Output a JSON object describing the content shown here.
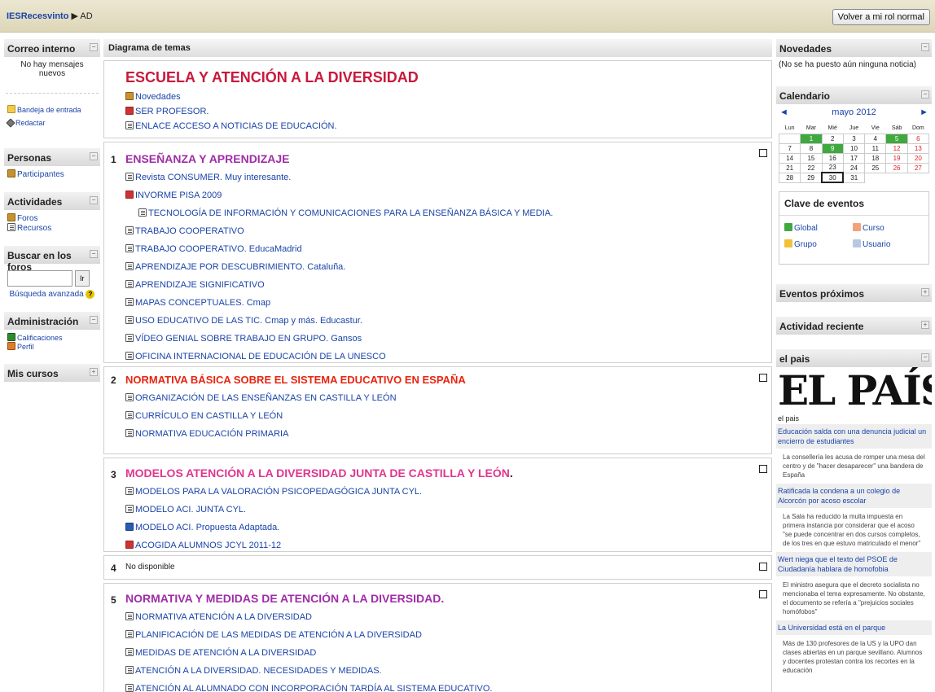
{
  "topbar": {
    "home": "IESRecesvinto",
    "sep": "▶",
    "current": "AD",
    "role_button": "Volver a mi rol normal"
  },
  "left": {
    "mail": {
      "title": "Correo interno",
      "no_msgs": "No hay mensajes nuevos",
      "inbox": "Bandeja de entrada",
      "compose": "Redactar"
    },
    "people": {
      "title": "Personas",
      "participants": "Participantes"
    },
    "activities": {
      "title": "Actividades",
      "forums": "Foros",
      "resources": "Recursos"
    },
    "search": {
      "title": "Buscar en los foros",
      "go": "Ir",
      "advanced": "Búsqueda avanzada",
      "help": "?"
    },
    "admin": {
      "title": "Administración",
      "grades": "Calificaciones",
      "profile": "Perfil"
    },
    "courses": {
      "title": "Mis cursos"
    }
  },
  "main": {
    "header": "Diagrama de temas",
    "sec0": {
      "title": "ESCUELA Y ATENCIÓN A LA DIVERSIDAD",
      "items": [
        "Novedades",
        "SER PROFESOR.",
        "ENLACE ACCESO A NOTICIAS DE EDUCACIÓN."
      ]
    },
    "sec1": {
      "num": "1",
      "title": "ENSEÑANZA Y APRENDIZAJE",
      "items": [
        "Revista CONSUMER. Muy interesante.",
        "INVORME PISA 2009",
        "TECNOLOGÍA DE INFORMACIÓN Y COMUNICACIONES PARA LA ENSEÑANZA BÁSICA Y MEDIA.",
        "TRABAJO COOPERATIVO",
        "TRABAJO COOPERATIVO. EducaMadrid",
        "APRENDIZAJE POR DESCUBRIMIENTO. Cataluña.",
        "APRENDIZAJE SIGNIFICATIVO",
        "MAPAS CONCEPTUALES. Cmap",
        "USO EDUCATIVO DE LAS TIC. Cmap y más. Educastur.",
        "VÍDEO GENIAL SOBRE TRABAJO EN GRUPO. Gansos",
        "OFICINA INTERNACIONAL DE EDUCACIÓN DE LA UNESCO"
      ]
    },
    "sec2": {
      "num": "2",
      "title": "NORMATIVA BÁSICA SOBRE EL SISTEMA EDUCATIVO EN ESPAÑA",
      "items": [
        "ORGANIZACIÓN DE LAS ENSEÑANZAS EN CASTILLA Y LEÓN",
        "CURRÍCULO EN CASTILLA Y LEÓN",
        "NORMATIVA EDUCACIÓN PRIMARIA"
      ]
    },
    "sec3": {
      "num": "3",
      "title": "MODELOS ATENCIÓN A LA DIVERSIDAD JUNTA DE CASTILLA Y LEÓN",
      "dot": ".",
      "items": [
        "MODELOS PARA LA VALORACIÓN PSICOPEDAGÓGICA JUNTA CYL.",
        "MODELO ACI. JUNTA CYL.",
        "MODELO ACI. Propuesta Adaptada.",
        "ACOGIDA ALUMNOS JCYL 2011-12"
      ]
    },
    "sec4": {
      "num": "4",
      "text": "No disponible"
    },
    "sec5": {
      "num": "5",
      "title": "NORMATIVA Y MEDIDAS DE ATENCIÓN A LA DIVERSIDAD.",
      "items": [
        "NORMATIVA ATENCIÓN A LA DIVERSIDAD",
        "PLANIFICACIÓN DE LAS MEDIDAS DE ATENCIÓN A LA DIVERSIDAD",
        "MEDIDAS DE ATENCIÓN A LA DIVERSIDAD",
        "ATENCIÓN A LA DIVERSIDAD. NECESIDADES Y MEDIDAS.",
        "ATENCIÓN AL ALUMNADO CON INCORPORACIÓN TARDÍA AL SISTEMA EDUCATIVO."
      ]
    }
  },
  "right": {
    "news": {
      "title": "Novedades",
      "text": "(No se ha puesto aún ninguna noticia)"
    },
    "calendar": {
      "title": "Calendario",
      "prev": "◄",
      "next": "►",
      "month": "mayo 2012",
      "days": [
        "Lun",
        "Mar",
        "Mié",
        "Jue",
        "Vie",
        "Sáb",
        "Dom"
      ]
    },
    "key": {
      "title": "Clave de eventos",
      "global": "Global",
      "course": "Curso",
      "group": "Grupo",
      "user": "Usuario"
    },
    "upcoming": {
      "title": "Eventos próximos"
    },
    "recent": {
      "title": "Actividad reciente"
    },
    "elpais": {
      "title": "el pais",
      "logo": "EL PAÍS",
      "label": "el pais",
      "items": [
        {
          "link": "Educación salda con una denuncia judicial un encierro de estudiantes",
          "desc": "La consellería les acusa de romper una mesa del centro y de \"hacer desaparecer\" una bandera de España"
        },
        {
          "link": "Ratificada la condena a un colegio de Alcorcón por acoso escolar",
          "desc": "La Sala ha reducido la multa impuesta en primera instancia por considerar que el acoso \"se puede concentrar en dos cursos completos, de los tres en que estuvo matriculado el menor\""
        },
        {
          "link": "Wert niega que el texto del PSOE de Ciudadanía hablara de homofobia",
          "desc": "El ministro asegura que el decreto socialista no mencionaba el tema expresamente. No obstante, el documento se refería a \"prejuicios sociales homófobos\""
        },
        {
          "link": "La Universidad está en el parque",
          "desc": "Más de 130 profesores de la US y la UPO dan clases abiertas en un parque sevillano. Alumnos y docentes protestan contra los recortes en la educación"
        }
      ]
    }
  }
}
